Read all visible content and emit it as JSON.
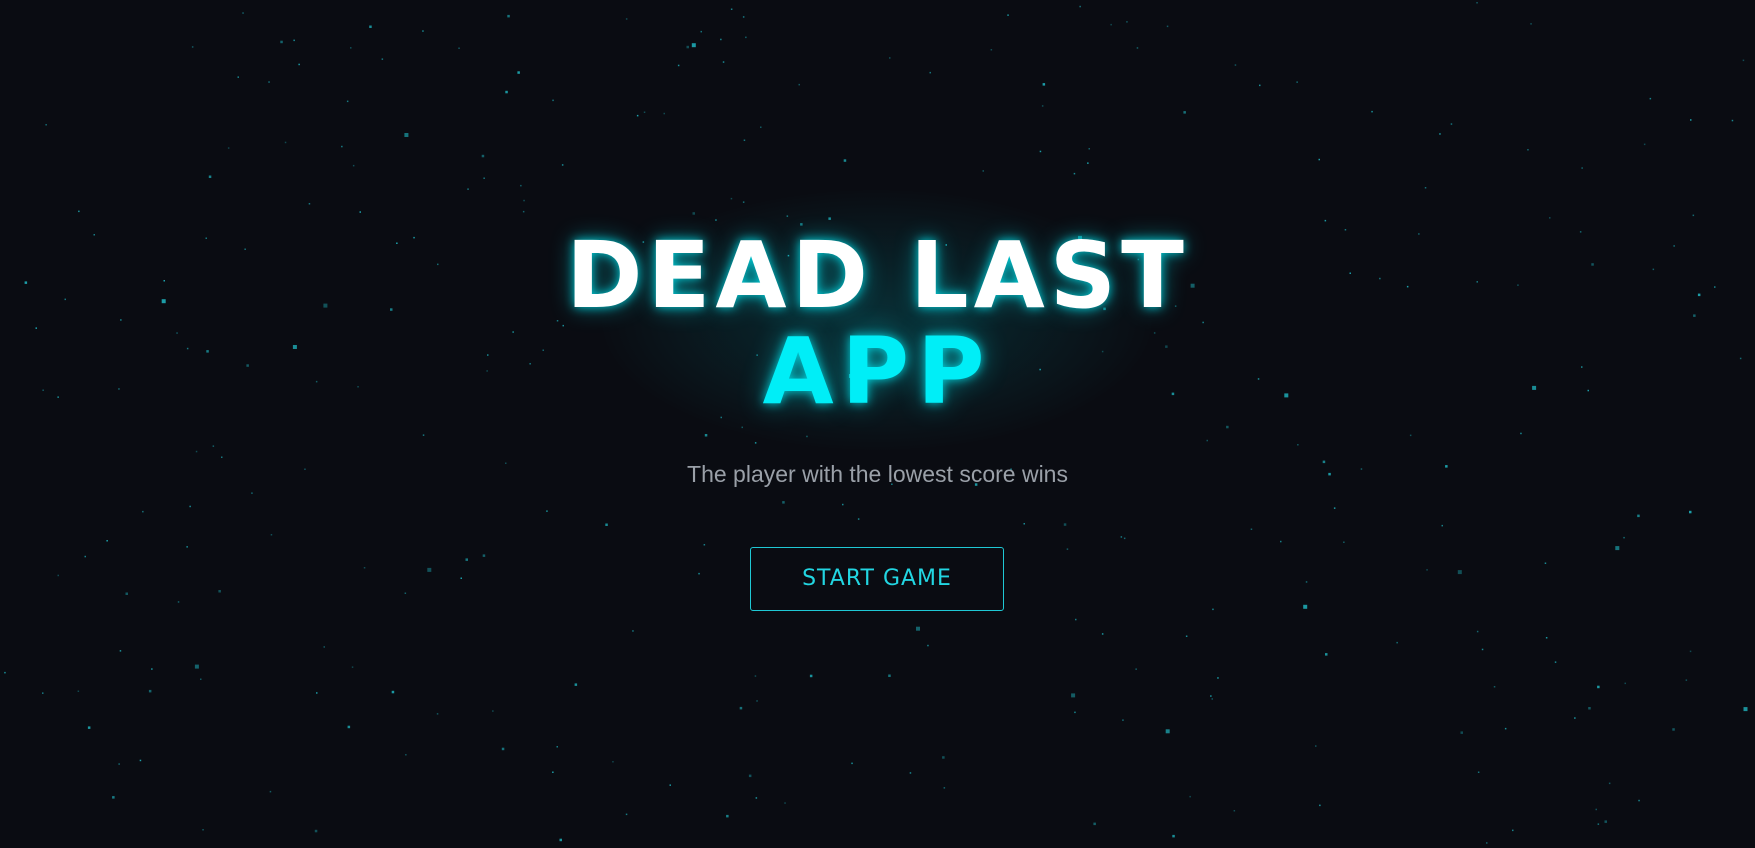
{
  "title": {
    "line1": "DEAD LAST",
    "line2": "APP"
  },
  "subtitle": "The player with the lowest score wins",
  "start_button_label": "START GAME",
  "colors": {
    "background": "#0a0c12",
    "accent": "#00eef7",
    "title_primary": "#ffffff",
    "subtitle": "#9aa0a8",
    "button_border": "#1fc8d4",
    "star": "#1fb3bd"
  }
}
